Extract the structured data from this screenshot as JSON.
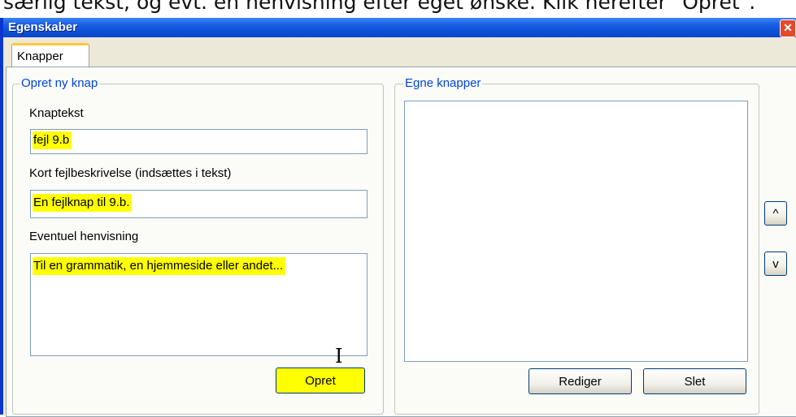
{
  "document": {
    "partial_text": "særlig tekst, og evt. en henvisning efter eget ønske. Klik herefter \"Opret\"."
  },
  "window": {
    "title": "Egenskaber",
    "close_glyph": "✕"
  },
  "tabs": [
    {
      "label": "Knapper",
      "selected": true
    }
  ],
  "create_group": {
    "legend": "Opret ny knap",
    "button_text_label": "Knaptekst",
    "button_text_value": "fejl 9.b",
    "short_desc_label": "Kort fejlbeskrivelse (indsættes i tekst)",
    "short_desc_value": "En fejlknap til 9.b.",
    "reference_label": "Eventuel henvisning",
    "reference_value": "Til en grammatik, en hjemmeside eller andet...",
    "create_button": "Opret"
  },
  "custom_group": {
    "legend": "Egne knapper",
    "items": [],
    "edit_button": "Rediger",
    "delete_button": "Slet"
  },
  "order_buttons": {
    "up": "^",
    "down": "v"
  },
  "colors": {
    "titlebar": "#0c4fd8",
    "highlight": "#ffff00",
    "legend_text": "#0046d5"
  }
}
